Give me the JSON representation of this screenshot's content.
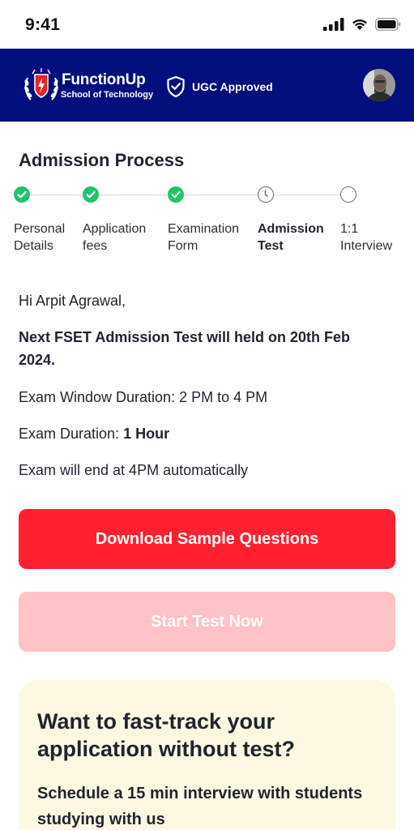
{
  "status_bar": {
    "time": "9:41"
  },
  "header": {
    "brand_name": "FunctionUp",
    "brand_subtitle": "School of Technology",
    "badge_label": "UGC Approved"
  },
  "page": {
    "title": "Admission Process"
  },
  "steps": [
    {
      "label": "Personal Details",
      "state": "completed"
    },
    {
      "label": "Application fees",
      "state": "completed"
    },
    {
      "label": "Examination Form",
      "state": "completed"
    },
    {
      "label": "Admission Test",
      "state": "current"
    },
    {
      "label": "1:1 Interview",
      "state": "pending"
    }
  ],
  "message": {
    "greeting": "Hi Arpit Agrawal,",
    "announcement": "Next FSET Admission Test will held on 20th Feb 2024.",
    "window_label": "Exam Window Duration:",
    "window_value": "2 PM to 4 PM",
    "duration_label": "Exam Duration:",
    "duration_value": "1 Hour",
    "end_note": "Exam will end at 4PM automatically"
  },
  "actions": {
    "download_label": "Download Sample Questions",
    "start_label": "Start Test Now",
    "start_disabled": true
  },
  "promo": {
    "title": "Want to fast-track your application without test?",
    "text": "Schedule a 15 min interview with students studying with us"
  },
  "colors": {
    "header_bg": "#020f7c",
    "step_done": "#22c36b",
    "primary_button": "#fe1f2f",
    "disabled_button": "#ffc2c6",
    "promo_bg": "#fdf8e1"
  }
}
